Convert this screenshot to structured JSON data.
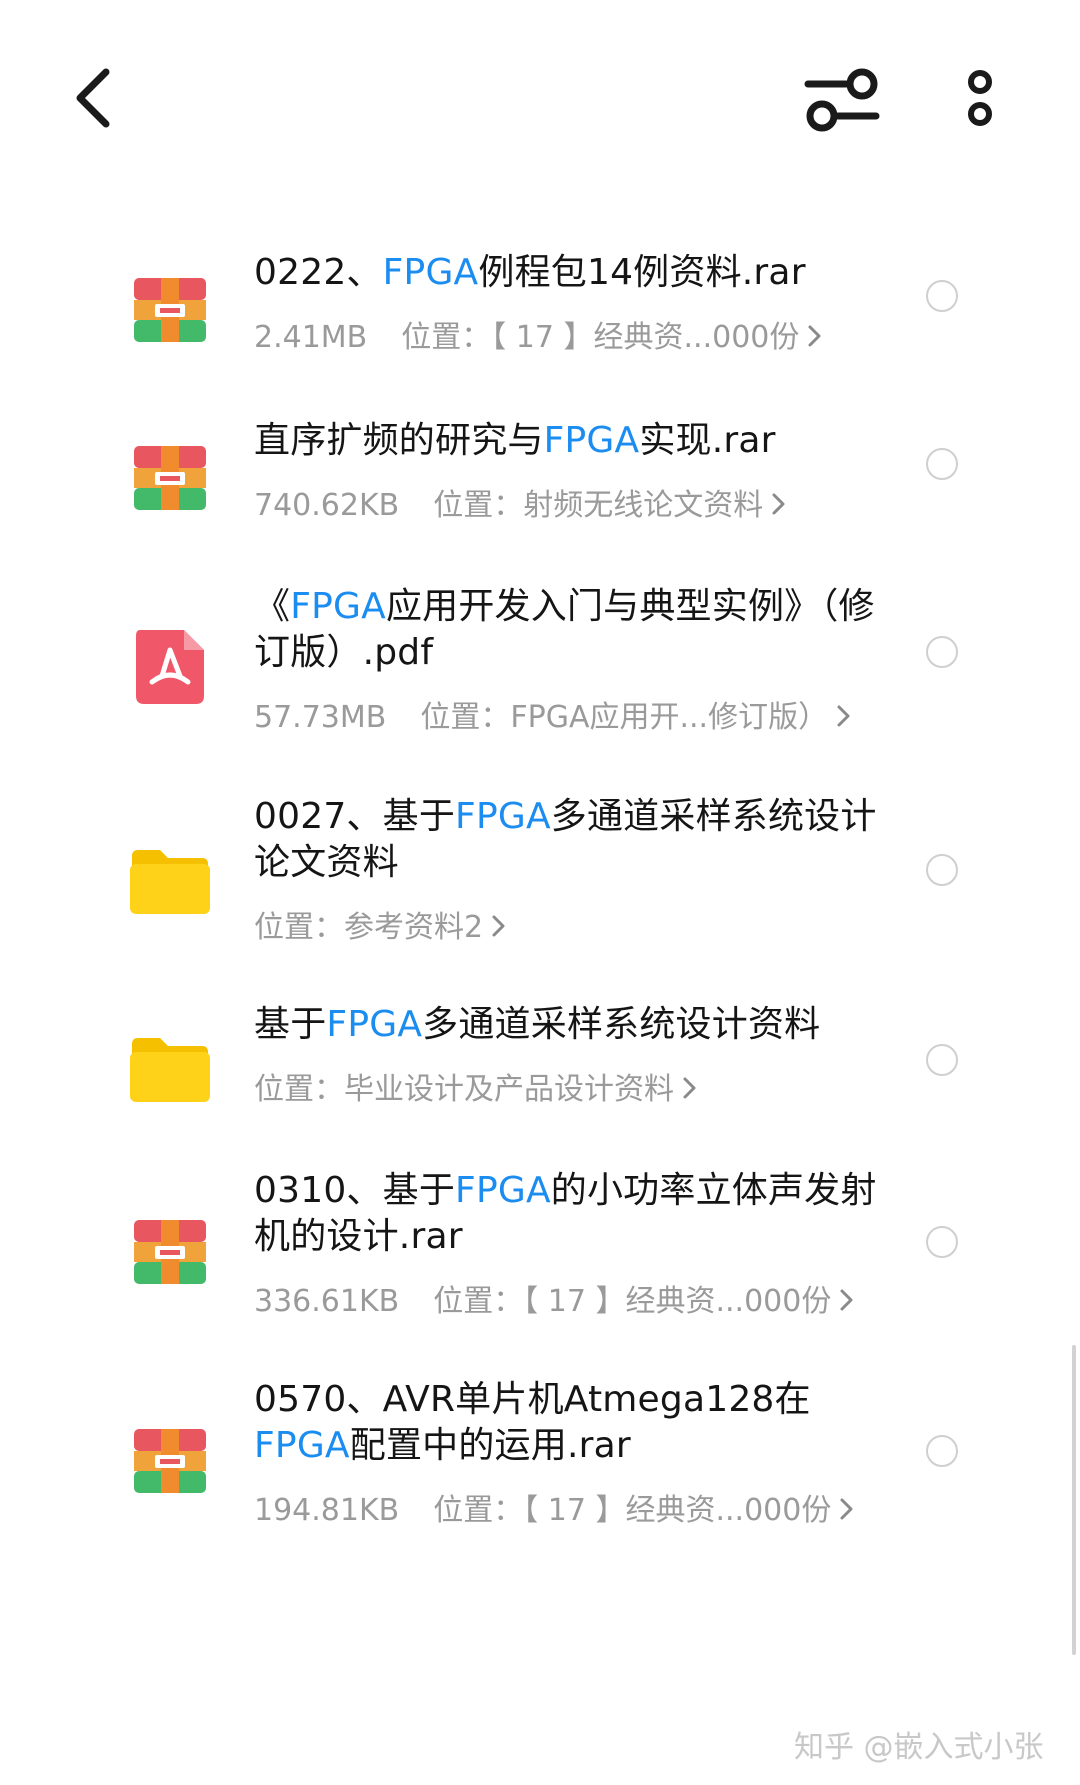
{
  "header": {
    "back_icon": "chevron-left-icon",
    "filter_icon": "sliders-icon",
    "more_icon": "more-vertical-icon"
  },
  "accent_color": "#1b8cf0",
  "files": [
    {
      "type": "archive",
      "icon": "archive-icon",
      "name_parts": [
        "0222、",
        "FPGA",
        "例程包14例资料.rar"
      ],
      "size": "2.41MB",
      "location_label": "位置：",
      "location": "【 17 】经典资...000份"
    },
    {
      "type": "archive",
      "icon": "archive-icon",
      "name_parts": [
        "直序扩频的研究与",
        "FPGA",
        "实现.rar"
      ],
      "size": "740.62KB",
      "location_label": "位置：",
      "location": "射频无线论文资料"
    },
    {
      "type": "pdf",
      "icon": "pdf-icon",
      "name_parts": [
        "《",
        "FPGA",
        "应用开发入门与典型实例》（修订版）.pdf"
      ],
      "size": "57.73MB",
      "location_label": "位置：",
      "location": "FPGA应用开...修订版）"
    },
    {
      "type": "folder",
      "icon": "folder-icon",
      "name_parts": [
        "0027、基于",
        "FPGA",
        "多通道采样系统设计论文资料"
      ],
      "size": "",
      "location_label": "位置：",
      "location": "参考资料2"
    },
    {
      "type": "folder",
      "icon": "folder-icon",
      "name_parts": [
        "基于",
        "FPGA",
        "多通道采样系统设计资料"
      ],
      "size": "",
      "location_label": "位置：",
      "location": "毕业设计及产品设计资料"
    },
    {
      "type": "archive",
      "icon": "archive-icon",
      "name_parts": [
        "0310、基于",
        "FPGA",
        "的小功率立体声发射机的设计.rar"
      ],
      "size": "336.61KB",
      "location_label": "位置：",
      "location": "【 17 】经典资...000份"
    },
    {
      "type": "archive",
      "icon": "archive-icon",
      "name_parts": [
        "0570、AVR单片机Atmega128在",
        "FPGA",
        "配置中的运用.rar"
      ],
      "size": "194.81KB",
      "location_label": "位置：",
      "location": "【 17 】经典资...000份"
    }
  ],
  "watermark": "知乎 @嵌入式小张"
}
